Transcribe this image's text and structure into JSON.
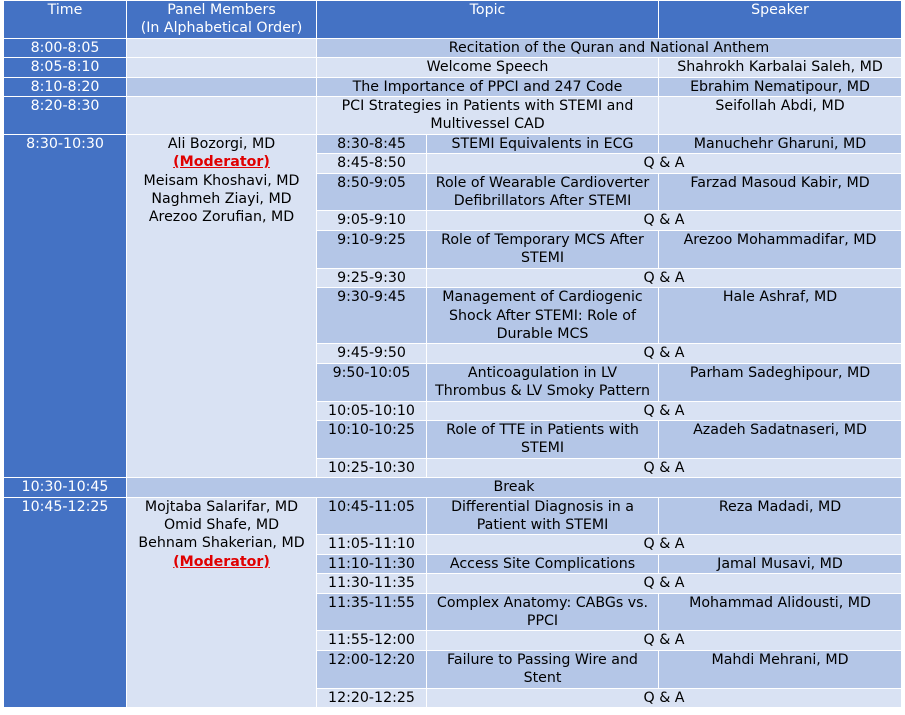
{
  "headers": {
    "time": "Time",
    "panel_1": "Panel Members",
    "panel_2": "(In Alphabetical Order)",
    "topic": "Topic",
    "speaker": "Speaker"
  },
  "opening": [
    {
      "time": "8:00-8:05",
      "topic": "Recitation of the Quran and National Anthem"
    },
    {
      "time": "8:05-8:10",
      "topic": "Welcome Speech",
      "speaker": "Shahrokh Karbalai Saleh, MD"
    },
    {
      "time": "8:10-8:20",
      "topic": "The Importance of PPCI and 247 Code",
      "speaker": "Ebrahim Nematipour, MD"
    },
    {
      "time": "8:20-8:30",
      "topic_1": "PCI Strategies in Patients with STEMI and",
      "topic_2": "Multivessel CAD",
      "speaker": "Seifollah Abdi, MD"
    }
  ],
  "session1": {
    "time": "8:30-10:30",
    "moderator_name": "Ali Bozorgi, MD",
    "moderator_tag": "(Moderator)",
    "members": [
      "Meisam Khoshavi, MD",
      "Naghmeh Ziayi, MD",
      "Arezoo Zorufian, MD"
    ],
    "rows": [
      {
        "time": "8:30-8:45",
        "topic": [
          "STEMI Equivalents in ECG"
        ],
        "speaker": "Manuchehr Gharuni, MD"
      },
      {
        "time": "8:45-8:50",
        "qa": "Q & A"
      },
      {
        "time": "8:50-9:05",
        "topic": [
          "Role of Wearable Cardioverter",
          "Defibrillators After STEMI"
        ],
        "speaker": "Farzad Masoud Kabir, MD"
      },
      {
        "time": "9:05-9:10",
        "qa": "Q & A"
      },
      {
        "time": "9:10-9:25",
        "topic": [
          "Role of Temporary MCS After",
          "STEMI"
        ],
        "speaker": "Arezoo Mohammadifar, MD"
      },
      {
        "time": "9:25-9:30",
        "qa": "Q & A"
      },
      {
        "time": "9:30-9:45",
        "topic": [
          "Management of Cardiogenic",
          "Shock After STEMI: Role of",
          "Durable MCS"
        ],
        "speaker": "Hale Ashraf, MD"
      },
      {
        "time": "9:45-9:50",
        "qa": "Q & A"
      },
      {
        "time": "9:50-10:05",
        "topic": [
          "Anticoagulation in LV",
          "Thrombus & LV Smoky Pattern"
        ],
        "speaker": "Parham Sadeghipour, MD"
      },
      {
        "time": "10:05-10:10",
        "qa": "Q & A"
      },
      {
        "time": "10:10-10:25",
        "topic": [
          "Role of TTE in Patients with",
          "STEMI"
        ],
        "speaker": "Azadeh Sadatnaseri, MD"
      },
      {
        "time": "10:25-10:30",
        "qa": "Q & A"
      }
    ]
  },
  "break": {
    "time": "10:30-10:45",
    "label": "Break"
  },
  "session2": {
    "time": "10:45-12:25",
    "members": [
      "Mojtaba Salarifar, MD",
      "Omid Shafe, MD",
      "Behnam Shakerian, MD"
    ],
    "moderator_tag": "(Moderator)",
    "rows": [
      {
        "time": "10:45-11:05",
        "topic": [
          "Differential Diagnosis in a",
          "Patient with STEMI"
        ],
        "speaker": "Reza Madadi, MD"
      },
      {
        "time": "11:05-11:10",
        "qa": "Q & A"
      },
      {
        "time": "11:10-11:30",
        "topic": [
          "Access Site Complications"
        ],
        "speaker": "Jamal Musavi, MD"
      },
      {
        "time": "11:30-11:35",
        "qa": "Q & A"
      },
      {
        "time": "11:35-11:55",
        "topic": [
          "Complex Anatomy: CABGs vs.",
          "PPCI"
        ],
        "speaker": "Mohammad Alidousti, MD"
      },
      {
        "time": "11:55-12:00",
        "qa": "Q & A"
      },
      {
        "time": "12:00-12:20",
        "topic": [
          "Failure to Passing Wire and",
          "Stent"
        ],
        "speaker": "Mahdi Mehrani, MD"
      },
      {
        "time": "12:20-12:25",
        "qa": "Q & A"
      }
    ]
  }
}
